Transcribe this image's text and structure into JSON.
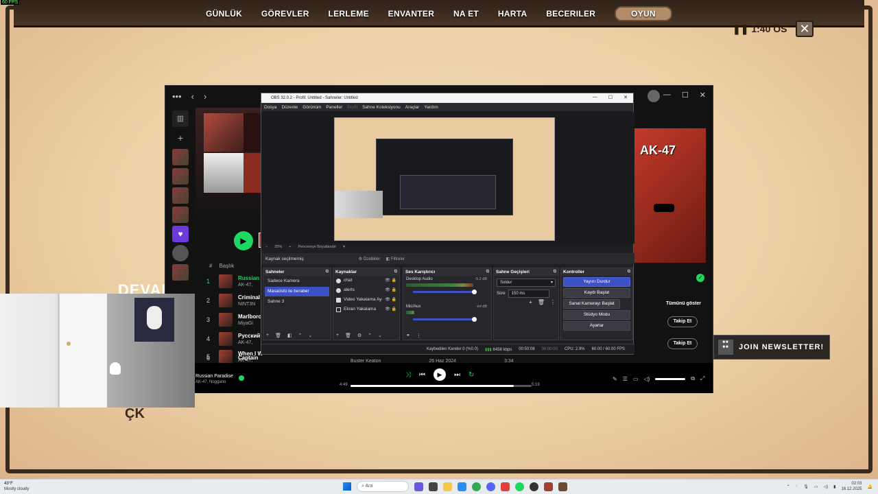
{
  "fps_counter": "60 FPS",
  "game": {
    "nav": [
      "GÜNLÜK",
      "GÖREVLER",
      "LERLEME",
      "ENVANTER",
      "NA ET",
      "HARTA",
      "BECERILER",
      "OYUN"
    ],
    "active_nav": "OYUN",
    "timer": "1:40 ÖS",
    "close_icon": "✕",
    "overlay_text_1": "DEVAM",
    "overlay_text_2": "ÇK",
    "newsletter": "JOIN NEWSLETTER!"
  },
  "spotify": {
    "top_icons": [
      "•••",
      "‹",
      "›"
    ],
    "window_controls": [
      "—",
      "☐",
      "✕"
    ],
    "tracks_header_num": "#",
    "tracks_header_title": "Başlık",
    "tracks": [
      {
        "num": "1",
        "title": "Russian P",
        "artist": "AK-47,",
        "playing": true
      },
      {
        "num": "2",
        "title": "Criminal",
        "artist": "NINT3N",
        "playing": false
      },
      {
        "num": "3",
        "title": "Marlboro",
        "artist": "MiyaGi",
        "playing": false
      },
      {
        "num": "4",
        "title": "Русский",
        "artist": "AK-47,",
        "playing": false
      },
      {
        "num": "5",
        "title": "When I W",
        "artist": "AK-47,",
        "playing": false
      },
      {
        "num": "6",
        "title": "Captain",
        "artist": "",
        "playing": false
      }
    ],
    "bottom_row": [
      "Buster Keaton",
      "26 Haz 2024",
      "3:34"
    ],
    "right_album": {
      "label": "AK-47"
    },
    "show_all": "Tümünü göster",
    "follow_label": "Takip Et",
    "now_playing": {
      "title": "Russian Paradise",
      "artist": "AK-47, Noggano"
    },
    "elapsed": "4:49",
    "total": "5:19",
    "progress_fraction": 0.9
  },
  "obs": {
    "title": "OBS 32.0.2 - Profil: Untitled - Sahneler: Untitled",
    "window_controls": [
      "—",
      "☐",
      "✕"
    ],
    "menu": [
      "Dosya",
      "Düzenle",
      "Görünüm",
      "Paneller",
      "Profil",
      "Sahne Koleksiyonu",
      "Araçlar",
      "Yardım"
    ],
    "preview_bar": [
      "−",
      "25%",
      "+",
      "Pencereye Boyutlandır",
      "▾"
    ],
    "no_source": "Kaynak seçilmemiş",
    "properties_btn": "⚙ Özellikler",
    "filters_btn": "◧ Filtreler",
    "docks": {
      "scenes": {
        "title": "Sahneler",
        "items": [
          "Sadece Kamera",
          "Masaüstü ile beraber",
          "Sahne 3"
        ],
        "selected": 1
      },
      "sources": {
        "title": "Kaynaklar",
        "items": [
          "chat",
          "alerts",
          "Video Yakalama Aygıtı",
          "Ekran Yakalama"
        ]
      },
      "mixer": {
        "title": "Ses Karıştırıcı",
        "channels": [
          {
            "name": "Desktop Audio",
            "db": "-5.2 dB",
            "level": 0.82
          },
          {
            "name": "Mic/Aux",
            "db": "-inf dB",
            "level": 0.1
          }
        ]
      },
      "transitions": {
        "title": "Sahne Geçişleri",
        "type": "Soldur",
        "duration_label": "Süre",
        "duration": "150 ms"
      },
      "controls": {
        "title": "Kontroller",
        "buttons": [
          "Yayını Durdur",
          "Kaydı Başlat",
          "Sanal Kamerayı Başlat",
          "Stüdyo Modu",
          "Ayarlar"
        ]
      }
    },
    "status": {
      "dropped": "Kaybedilen Kareler 0 (%0.0)",
      "bitrate": "8458 kbps",
      "stream_time": "00:50:08",
      "rec_time": "00:00:00",
      "cpu": "CPU: 2.9%",
      "fps": "60.00 / 60.00 FPS"
    }
  },
  "taskbar": {
    "weather_temp": "43°F",
    "weather_desc": "Mostly cloudy",
    "search_placeholder": "Ara",
    "time": "02:03",
    "date": "16.12.2025"
  }
}
